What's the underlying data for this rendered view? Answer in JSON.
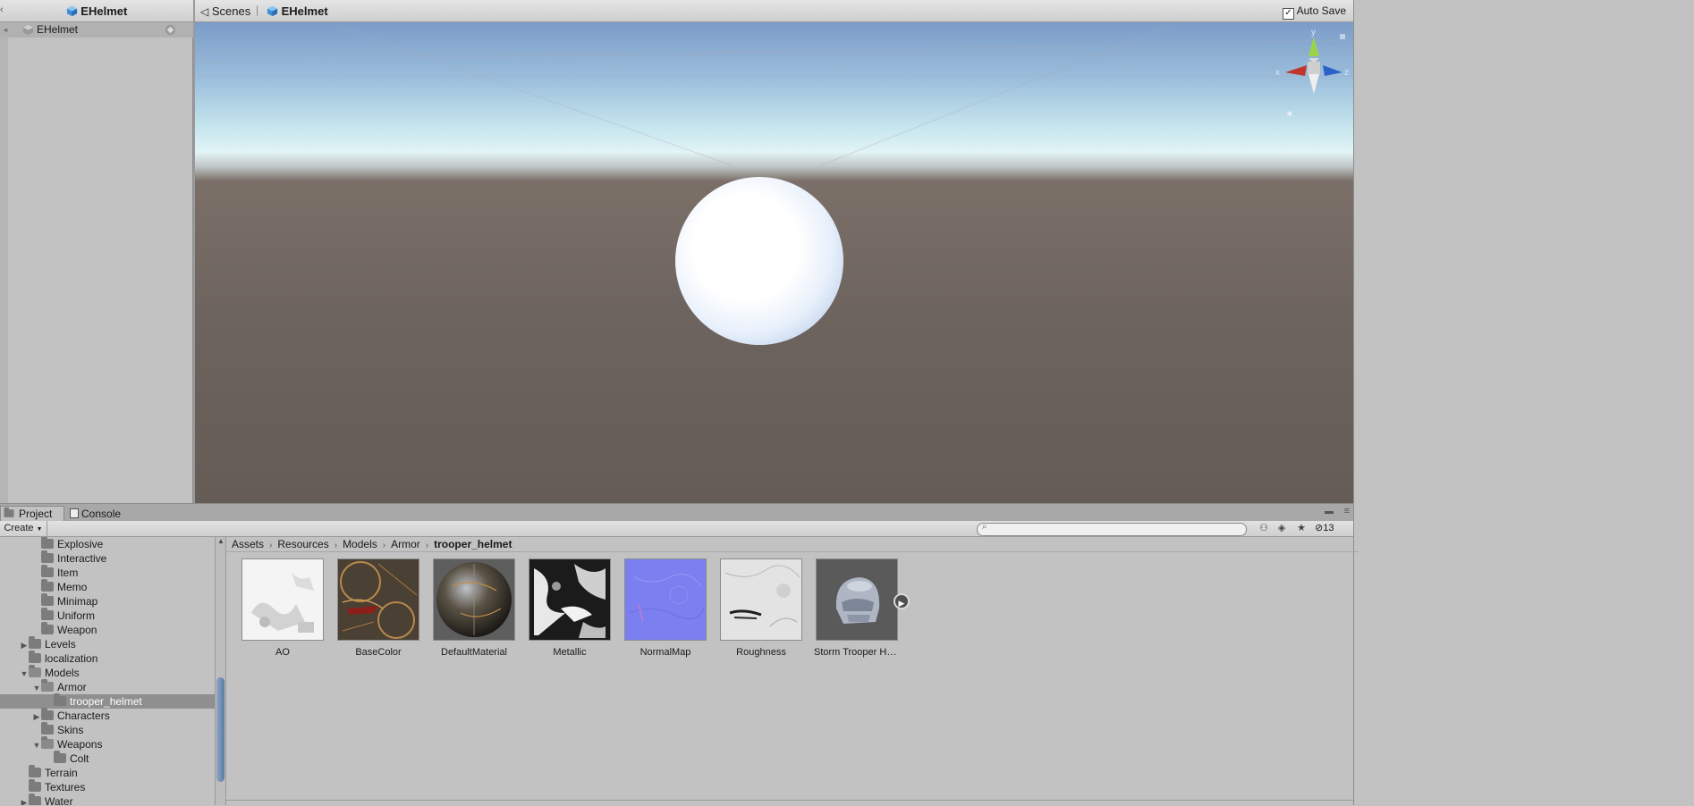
{
  "hierarchy": {
    "title": "EHelmet",
    "root_item": "EHelmet"
  },
  "scene_view": {
    "tab_scenes": "Scenes",
    "tab_scene_name": "EHelmet",
    "auto_save_label": "Auto Save",
    "auto_save_checked": true,
    "gizmo": {
      "x": "x",
      "y": "y",
      "z": "z"
    },
    "colors": {
      "sky_top": "#7b9cc8",
      "horizon": "#e2f4f6",
      "ground": "#6b605a"
    }
  },
  "bottom_panel": {
    "tab_project": "Project",
    "tab_console": "Console",
    "create_label": "Create",
    "search_placeholder": "",
    "hidden_count": "13"
  },
  "project_tree": [
    {
      "label": "Explosive",
      "level": 2,
      "arrow": ""
    },
    {
      "label": "Interactive",
      "level": 2,
      "arrow": ""
    },
    {
      "label": "Item",
      "level": 2,
      "arrow": ""
    },
    {
      "label": "Memo",
      "level": 2,
      "arrow": ""
    },
    {
      "label": "Minimap",
      "level": 2,
      "arrow": ""
    },
    {
      "label": "Uniform",
      "level": 2,
      "arrow": ""
    },
    {
      "label": "Weapon",
      "level": 2,
      "arrow": ""
    },
    {
      "label": "Levels",
      "level": 1,
      "arrow": "▶"
    },
    {
      "label": "localization",
      "level": 1,
      "arrow": ""
    },
    {
      "label": "Models",
      "level": 1,
      "arrow": "▼"
    },
    {
      "label": "Armor",
      "level": 2,
      "arrow": "▼"
    },
    {
      "label": "trooper_helmet",
      "level": 3,
      "arrow": "",
      "selected": true
    },
    {
      "label": "Characters",
      "level": 2,
      "arrow": "▶"
    },
    {
      "label": "Skins",
      "level": 2,
      "arrow": ""
    },
    {
      "label": "Weapons",
      "level": 2,
      "arrow": "▼"
    },
    {
      "label": "Colt",
      "level": 3,
      "arrow": ""
    },
    {
      "label": "Terrain",
      "level": 1,
      "arrow": ""
    },
    {
      "label": "Textures",
      "level": 1,
      "arrow": ""
    },
    {
      "label": "Water",
      "level": 1,
      "arrow": "▶"
    }
  ],
  "breadcrumb": [
    "Assets",
    "Resources",
    "Models",
    "Armor",
    "trooper_helmet"
  ],
  "assets": [
    {
      "label": "AO",
      "icon": "ao-texture"
    },
    {
      "label": "BaseColor",
      "icon": "basecolor-texture"
    },
    {
      "label": "DefaultMaterial",
      "icon": "material-sphere"
    },
    {
      "label": "Metallic",
      "icon": "metallic-texture"
    },
    {
      "label": "NormalMap",
      "icon": "normalmap-texture"
    },
    {
      "label": "Roughness",
      "icon": "roughness-texture"
    },
    {
      "label": "Storm Trooper He...",
      "icon": "helmet-model"
    }
  ]
}
